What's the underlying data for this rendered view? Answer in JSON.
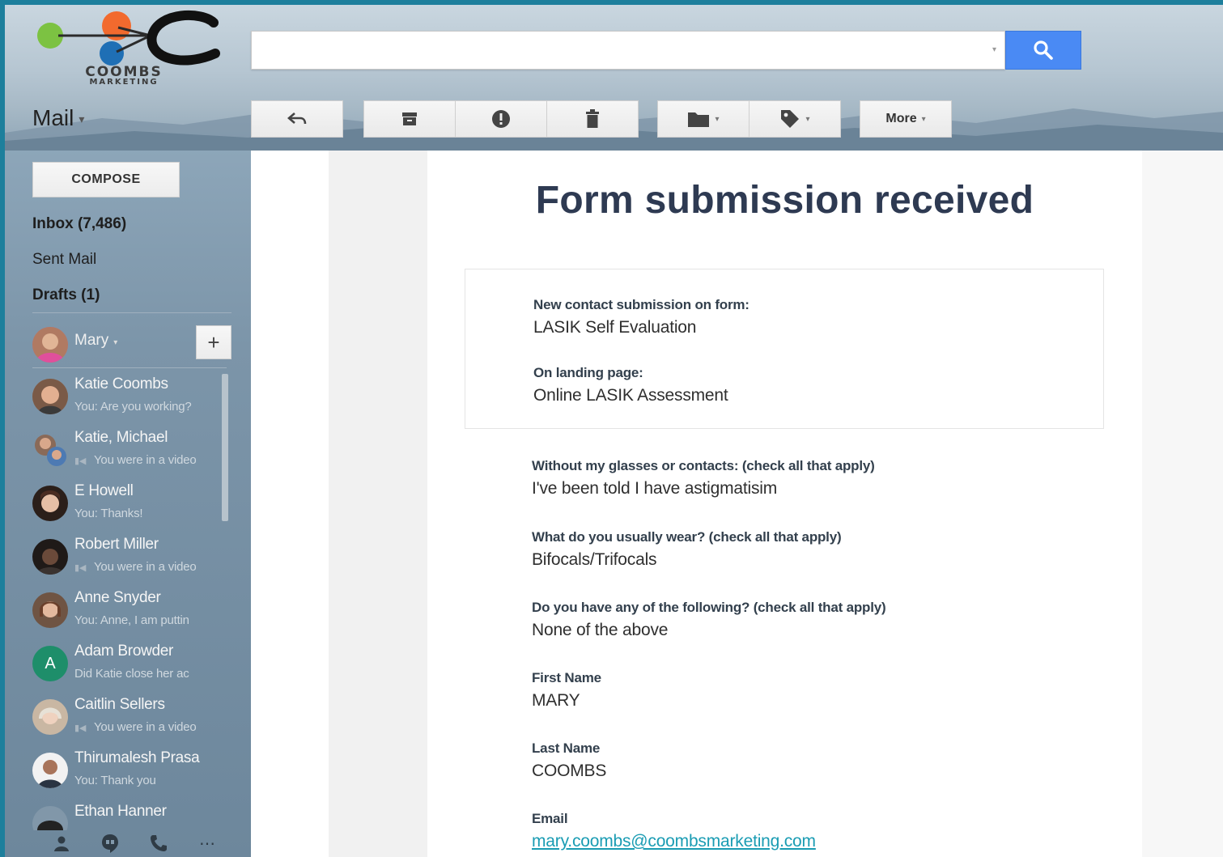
{
  "header": {
    "logo_text": "COOMBS",
    "logo_subtext": "MARKETING",
    "app_label": "Mail",
    "search_placeholder": "",
    "toolbar": {
      "more_label": "More"
    }
  },
  "sidebar": {
    "compose_label": "COMPOSE",
    "folders": [
      {
        "label": "Inbox (7,486)",
        "bold": true
      },
      {
        "label": "Sent Mail",
        "bold": false
      },
      {
        "label": "Drafts (1)",
        "bold": true
      }
    ],
    "me": {
      "name": "Mary"
    },
    "contacts": [
      {
        "name": "Katie Coombs",
        "snippet": "You: Are you working?",
        "video": false,
        "avatar_color": "#b07b5c"
      },
      {
        "name": "Katie, Michael",
        "snippet": "You were in a video",
        "video": true,
        "avatar_color": "#7e6a5a"
      },
      {
        "name": "E Howell",
        "snippet": "You: Thanks!",
        "video": false,
        "avatar_color": "#3b2c25"
      },
      {
        "name": "Robert Miller",
        "snippet": "You were in a video",
        "video": true,
        "avatar_color": "#2d2623"
      },
      {
        "name": "Anne Snyder",
        "snippet": "You: Anne, I am puttin",
        "video": false,
        "avatar_color": "#8a6a55"
      },
      {
        "name": "Adam Browder",
        "snippet": "Did Katie close her ac",
        "video": false,
        "avatar_color": "#1e8e6a",
        "initial": "A"
      },
      {
        "name": "Caitlin Sellers",
        "snippet": "You were in a video",
        "video": true,
        "avatar_color": "#c9b7a3"
      },
      {
        "name": "Thirumalesh Prasa",
        "snippet": "You: Thank you",
        "video": false,
        "avatar_color": "#e6e6e6"
      },
      {
        "name": "Ethan Hanner",
        "snippet": "",
        "video": false,
        "avatar_color": "#2c2c2c"
      }
    ]
  },
  "email": {
    "title": "Form submission received",
    "card_fields": [
      {
        "label": "New contact submission on form:",
        "value": "LASIK Self Evaluation"
      },
      {
        "label": "On landing page:",
        "value": "Online LASIK Assessment"
      }
    ],
    "fields": [
      {
        "label": "Without my glasses or contacts: (check all that apply)",
        "value": "I've been told I have astigmatisim"
      },
      {
        "label": "What do you usually wear? (check all that apply)",
        "value": "Bifocals/Trifocals"
      },
      {
        "label": "Do you have any of the following? (check all that apply)",
        "value": "None of the above"
      },
      {
        "label": "First Name",
        "value": "MARY"
      },
      {
        "label": "Last Name",
        "value": "COOMBS"
      },
      {
        "label": "Email",
        "value": "mary.coombs@coombsmarketing.com"
      }
    ]
  },
  "colors": {
    "accent_blue": "#4a8af4",
    "frame_border": "#1d7f9c",
    "title_navy": "#2e3a52",
    "link": "#1a9cb3"
  }
}
